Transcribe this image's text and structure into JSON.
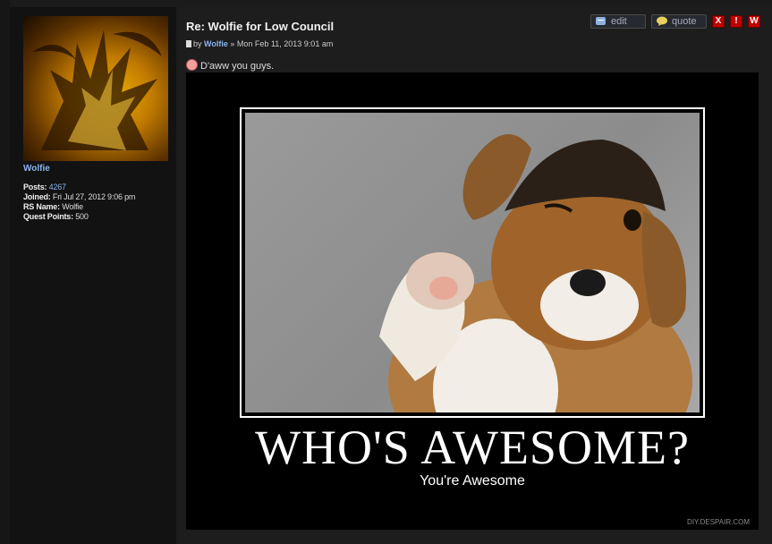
{
  "author": {
    "name": "Wolfie",
    "posts_label": "Posts:",
    "posts": "4267",
    "joined_label": "Joined:",
    "joined": "Fri Jul 27, 2012 9:06 pm",
    "rsname_label": "RS Name:",
    "rsname": "Wolfie",
    "qp_label": "Quest Points:",
    "qp": "500"
  },
  "post": {
    "title": "Re: Wolfie for Low Council",
    "by": "by",
    "author": "Wolfie",
    "sep": "»",
    "date": "Mon Feb 11, 2013 9:01 am",
    "text": "D'aww you guys."
  },
  "toolbar": {
    "edit": "edit",
    "quote": "quote",
    "x": "X",
    "report": "!",
    "warn": "W"
  },
  "poster": {
    "headline": "WHO'S AWESOME?",
    "subline": "You're Awesome",
    "watermark": "DIY.DESPAIR.COM"
  }
}
